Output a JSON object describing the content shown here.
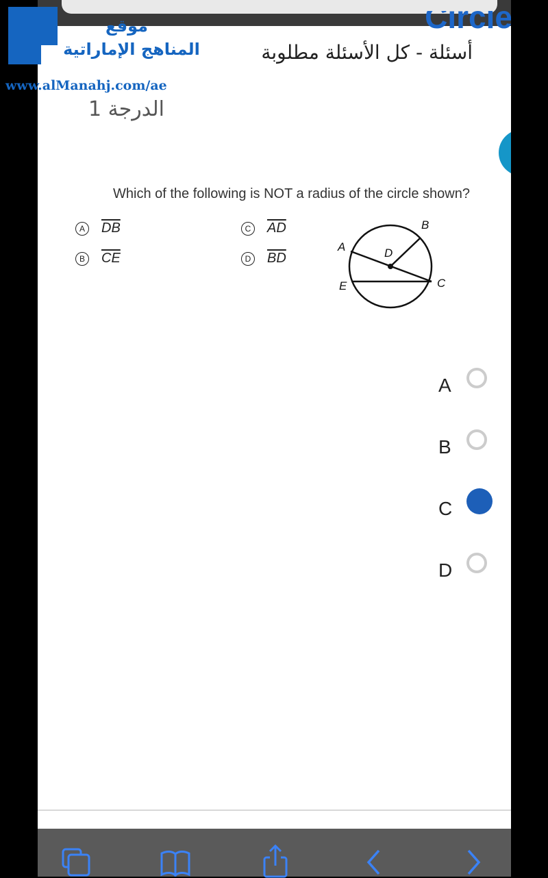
{
  "header": {
    "circle_word": "Circle",
    "quiz_title": "أسئلة - كل الأسئلة مطلوبة"
  },
  "watermark": {
    "line1": "موقع",
    "line2": "المناهج الإماراتية",
    "url": "www.alManahj.com/ae"
  },
  "question_card": {
    "grade": "الدرجة 1",
    "number": "1",
    "text": "Which of the following is NOT a radius of the circle shown?",
    "choices": [
      {
        "badge": "A",
        "segment": "DB"
      },
      {
        "badge": "B",
        "segment": "CE"
      },
      {
        "badge": "C",
        "segment": "AD"
      },
      {
        "badge": "D",
        "segment": "BD"
      }
    ],
    "diagram_labels": {
      "A": "A",
      "B": "B",
      "C": "C",
      "D": "D",
      "E": "E"
    }
  },
  "answers": [
    {
      "label": "A",
      "selected": false
    },
    {
      "label": "B",
      "selected": false
    },
    {
      "label": "C",
      "selected": true
    },
    {
      "label": "D",
      "selected": false
    }
  ],
  "toolbar": {
    "icons": [
      "tabs-icon",
      "bookmarks-icon",
      "share-icon",
      "back-icon",
      "forward-icon"
    ]
  },
  "colors": {
    "accent": "#1596c8",
    "selected_radio": "#1d5fb8",
    "toolbar_icon": "#3b82f6"
  }
}
